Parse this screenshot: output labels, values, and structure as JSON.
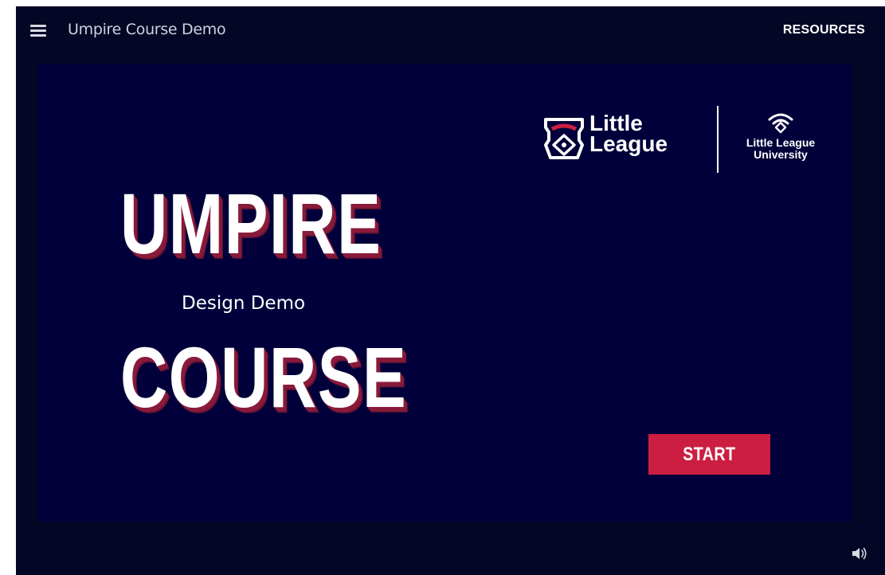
{
  "header": {
    "course_title": "Umpire Course Demo",
    "resources_label": "RESOURCES",
    "menu_icon": "hamburger-menu-icon"
  },
  "slide": {
    "title_line1": "UMPIRE",
    "subtitle": "Design Demo",
    "title_line2": "COURSE",
    "start_label": "START",
    "logos": {
      "little_league": "Little League",
      "little_league_university": "Little League University"
    }
  },
  "footer": {
    "audio_icon": "speaker-icon"
  },
  "colors": {
    "app_background": "#040625",
    "slide_background": "#01003a",
    "accent": "#cc1e41",
    "title_shadow": "#8a1a3a",
    "text": "#ffffff"
  }
}
